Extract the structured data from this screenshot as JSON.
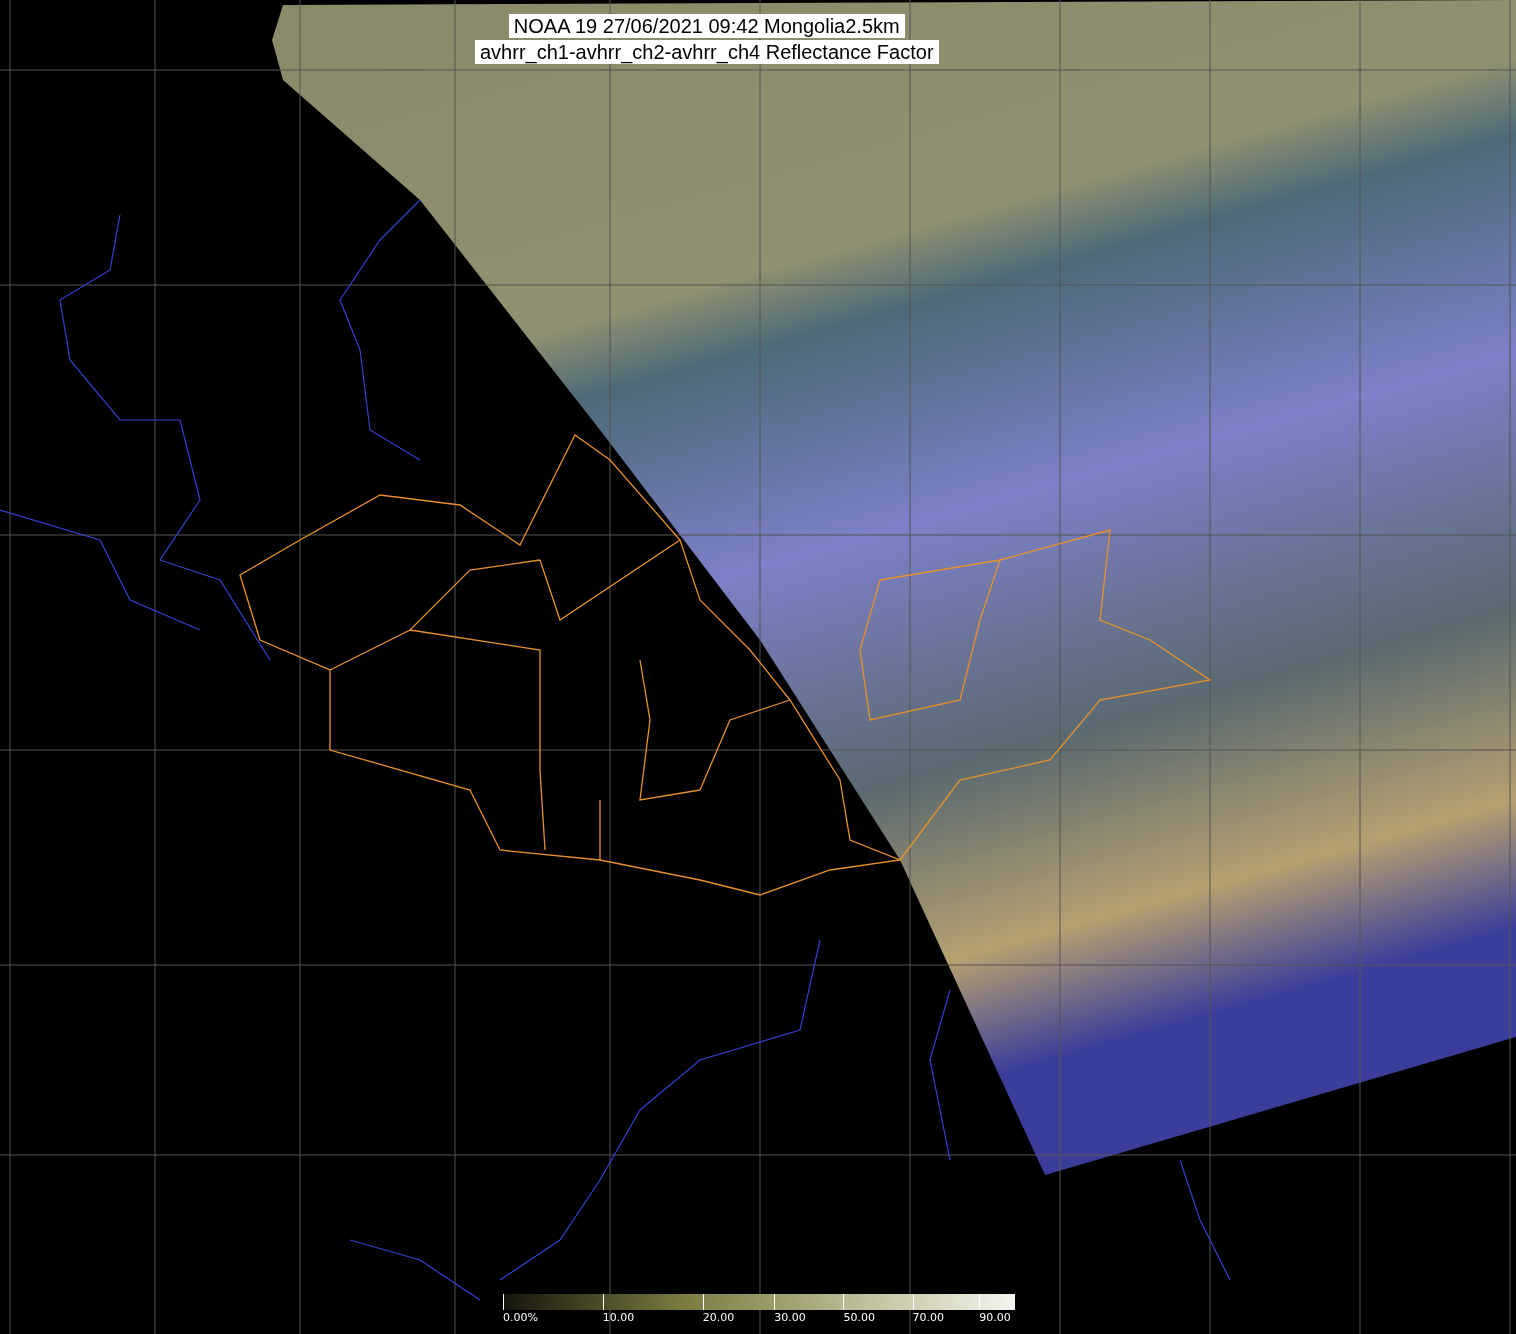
{
  "title": {
    "lines": [
      "NOAA 19 27/06/2021 09:42 Mongolia2.5km",
      "avhrr_ch1-avhrr_ch2-avhrr_ch4 Reflectance Factor"
    ]
  },
  "colorbar": {
    "ticks": [
      "0.00%",
      "10.00",
      "20.00",
      "30.00",
      "50.00",
      "70.00",
      "90.00"
    ]
  }
}
